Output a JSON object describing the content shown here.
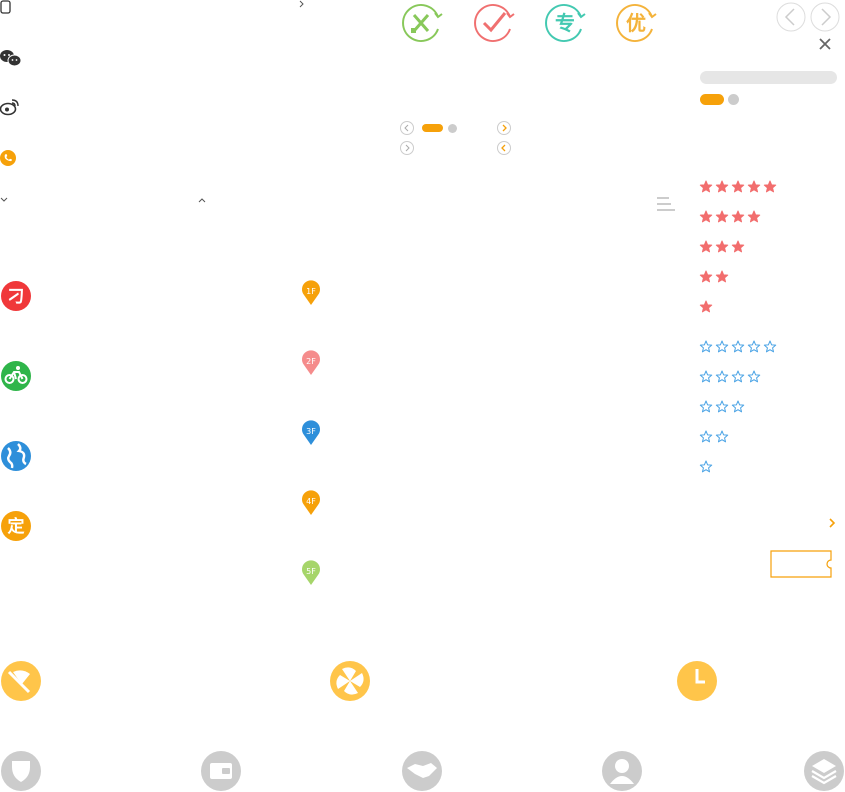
{
  "colors": {
    "orange": "#F6A10A",
    "yellow": "#FFC54A",
    "red_star": "#F26D6D",
    "blue_star": "#4AA3E5",
    "circle_green": "#88C85A",
    "circle_red": "#F07070",
    "circle_teal": "#43C9B1",
    "circle_gold": "#F4B33B",
    "gray": "#CCCCCC",
    "light_gray": "#E6E6E6"
  },
  "left_icons": [
    {
      "name": "phone-outline-icon"
    },
    {
      "name": "wechat-icon"
    },
    {
      "name": "weibo-icon"
    },
    {
      "name": "call-icon"
    }
  ],
  "badges": [
    {
      "name": "badge-ji-icon",
      "glyph": "刁",
      "color": "#F0383A"
    },
    {
      "name": "badge-bike-icon",
      "glyph": "",
      "color": "#2FB54A"
    },
    {
      "name": "badge-globe-icon",
      "glyph": "",
      "color": "#2E8FDA"
    },
    {
      "name": "badge-ding-icon",
      "glyph": "定",
      "color": "#F6A10A"
    }
  ],
  "floor_pins": [
    {
      "label": "1F",
      "color": "#F6A10A"
    },
    {
      "label": "2F",
      "color": "#F58C8C"
    },
    {
      "label": "3F",
      "color": "#2E8FDA"
    },
    {
      "label": "4F",
      "color": "#F6A10A"
    },
    {
      "label": "5F",
      "color": "#A6D56A"
    }
  ],
  "top_circles": [
    {
      "name": "edit-tool-icon",
      "glyph": "",
      "color": "#88C85A"
    },
    {
      "name": "check-icon",
      "glyph": "",
      "color": "#F07070"
    },
    {
      "name": "zhuan-icon",
      "glyph": "专",
      "color": "#43C9B1"
    },
    {
      "name": "you-icon",
      "glyph": "优",
      "color": "#F4B33B"
    }
  ],
  "star_ratings_filled": [
    5,
    4,
    3,
    2,
    1
  ],
  "star_ratings_outline": [
    5,
    4,
    3,
    2,
    1
  ],
  "bottom_icons_row1": [
    {
      "name": "flag-badge-icon"
    },
    {
      "name": "clover-badge-icon"
    },
    {
      "name": "clock-badge-icon"
    }
  ],
  "bottom_icons_row2": [
    {
      "name": "shield-icon"
    },
    {
      "name": "wallet-icon"
    },
    {
      "name": "handshake-icon"
    },
    {
      "name": "user-icon"
    },
    {
      "name": "layers-icon"
    }
  ]
}
